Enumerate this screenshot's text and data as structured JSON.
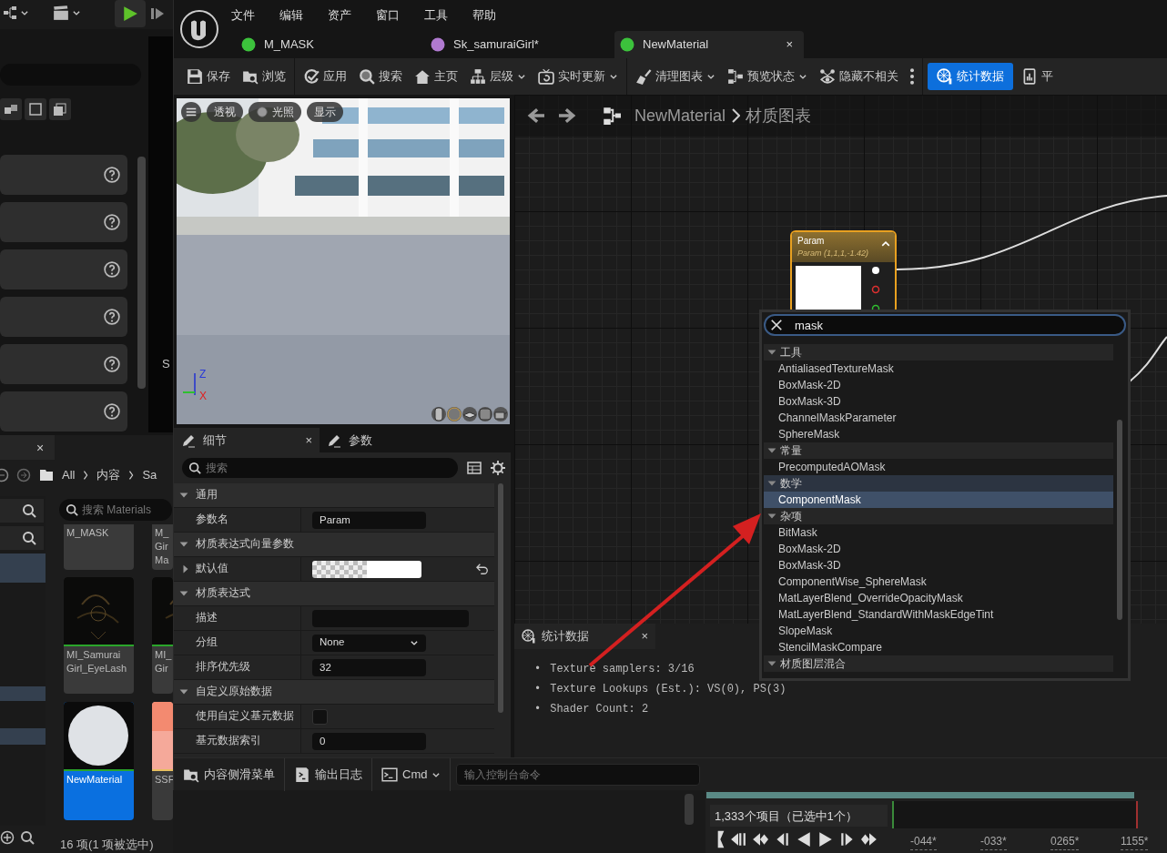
{
  "background_editor": {
    "side_label": "S",
    "content_browser": {
      "close": "×",
      "breadcrumbs": [
        "All",
        "内容",
        "Sa"
      ],
      "search_placeholder": "搜索 Materials",
      "assets": [
        {
          "label": "M_MASK",
          "kind": "none",
          "selected": false
        },
        {
          "label": "M_ Gir Ma",
          "kind": "none",
          "selected": false
        },
        {
          "label": "MI_Samurai Girl_EyeLash",
          "kind": "texture",
          "selected": false
        },
        {
          "label": "MI_ Gir",
          "kind": "texture",
          "selected": false
        },
        {
          "label": "NewMaterial",
          "kind": "sphere",
          "selected": true
        },
        {
          "label": "SSF",
          "kind": "salmon",
          "selected": false
        }
      ],
      "status": "16 项(1 项被选中)"
    },
    "outliner": {
      "status": "1,333个项目（已选中1个）"
    },
    "timeline": {
      "ticks": [
        "-044*",
        "-033*",
        "0265*",
        "1155*"
      ]
    }
  },
  "editor": {
    "menu": [
      "文件",
      "编辑",
      "资产",
      "窗口",
      "工具",
      "帮助"
    ],
    "tabs": [
      {
        "label": "M_MASK",
        "color": "#3cc23c",
        "selected": false
      },
      {
        "label": "Sk_samuraiGirl*",
        "color": "#b07ad0",
        "selected": false
      },
      {
        "label": "NewMaterial",
        "color": "#3cc23c",
        "selected": true,
        "close": "×"
      }
    ],
    "toolbar": [
      {
        "kind": "save",
        "label": "保存",
        "dropdown": false,
        "active": false
      },
      {
        "kind": "browse",
        "label": "浏览",
        "dropdown": false,
        "active": false
      },
      {
        "kind": "apply",
        "label": "应用",
        "dropdown": false,
        "active": false
      },
      {
        "kind": "search",
        "label": "搜索",
        "dropdown": false,
        "active": false
      },
      {
        "kind": "home",
        "label": "主页",
        "dropdown": false,
        "active": false
      },
      {
        "kind": "hierarchy",
        "label": "层级",
        "dropdown": true,
        "active": false
      },
      {
        "kind": "live",
        "label": "实时更新",
        "dropdown": true,
        "active": false
      },
      {
        "kind": "clean",
        "label": "清理图表",
        "dropdown": true,
        "active": false
      },
      {
        "kind": "preview",
        "label": "预览状态",
        "dropdown": true,
        "active": false
      },
      {
        "kind": "hide",
        "label": "隐藏不相关",
        "dropdown": false,
        "active": false
      },
      {
        "kind": "more",
        "dropdown": false,
        "active": false
      },
      {
        "kind": "stats",
        "label": "统计数据",
        "dropdown": false,
        "active": true
      },
      {
        "kind": "platform",
        "label": "平",
        "dropdown": false,
        "active": false
      }
    ],
    "viewport": {
      "buttons": [
        "透视",
        "光照",
        "显示"
      ],
      "axes": [
        "Z",
        "X"
      ]
    },
    "details": {
      "tabs": [
        {
          "label": "细节",
          "selected": true,
          "close": "×"
        },
        {
          "label": "参数",
          "selected": false
        }
      ],
      "search_placeholder": "搜索",
      "properties": [
        {
          "kind": "section",
          "label": "通用",
          "expanded": true
        },
        {
          "kind": "text",
          "label": "参数名",
          "value": "Param"
        },
        {
          "kind": "section",
          "label": "材质表达式向量参数",
          "expanded": true
        },
        {
          "kind": "color",
          "label": "默认值",
          "color": "#ffffff",
          "expanded": false
        },
        {
          "kind": "section",
          "label": "材质表达式",
          "expanded": true
        },
        {
          "kind": "text",
          "label": "描述"
        },
        {
          "kind": "dropdown",
          "label": "分组",
          "value": "None"
        },
        {
          "kind": "text",
          "label": "排序优先级",
          "value": "32"
        },
        {
          "kind": "section",
          "label": "自定义原始数据",
          "expanded": true
        },
        {
          "kind": "checkbox",
          "label": "使用自定义基元数据",
          "checked": false
        },
        {
          "kind": "text",
          "label": "基元数据索引",
          "value": "0"
        }
      ]
    },
    "graph": {
      "breadcrumb": [
        "NewMaterial",
        "材质图表"
      ],
      "node": {
        "title": "Param",
        "subtitle": "Param (1,1,1,-1.42)"
      }
    },
    "stats": {
      "tab": "统计数据",
      "close": "×",
      "bullet": "•",
      "lines": [
        "Texture samplers: 3/16",
        "Texture Lookups (Est.): VS(0), PS(3)",
        "Shader Count: 2"
      ]
    },
    "search_popup": {
      "value": "mask",
      "items": [
        {
          "kind": "category",
          "label": "工具",
          "active": false
        },
        {
          "kind": "item",
          "label": "AntialiasedTextureMask",
          "selected": false
        },
        {
          "kind": "item",
          "label": "BoxMask-2D",
          "selected": false
        },
        {
          "kind": "item",
          "label": "BoxMask-3D",
          "selected": false
        },
        {
          "kind": "item",
          "label": "ChannelMaskParameter",
          "selected": false
        },
        {
          "kind": "item",
          "label": "SphereMask",
          "selected": false
        },
        {
          "kind": "category",
          "label": "常量",
          "active": false
        },
        {
          "kind": "item",
          "label": "PrecomputedAOMask",
          "selected": false
        },
        {
          "kind": "category",
          "label": "数学",
          "active": true
        },
        {
          "kind": "item",
          "label": "ComponentMask",
          "selected": true
        },
        {
          "kind": "category",
          "label": "杂项",
          "active": false
        },
        {
          "kind": "item",
          "label": "BitMask",
          "selected": false
        },
        {
          "kind": "item",
          "label": "BoxMask-2D",
          "selected": false
        },
        {
          "kind": "item",
          "label": "BoxMask-3D",
          "selected": false
        },
        {
          "kind": "item",
          "label": "ComponentWise_SphereMask",
          "selected": false
        },
        {
          "kind": "item",
          "label": "MatLayerBlend_OverrideOpacityMask",
          "selected": false
        },
        {
          "kind": "item",
          "label": "MatLayerBlend_StandardWithMaskEdgeTint",
          "selected": false
        },
        {
          "kind": "item",
          "label": "SlopeMask",
          "selected": false
        },
        {
          "kind": "item",
          "label": "StencilMaskCompare",
          "selected": false
        },
        {
          "kind": "category",
          "label": "材质图层混合",
          "active": false
        }
      ]
    },
    "bottom_bar": {
      "buttons": [
        {
          "kind": "drawer",
          "label": "内容侧滑菜单",
          "dropdown": false
        },
        {
          "kind": "log",
          "label": "输出日志",
          "dropdown": false
        },
        {
          "kind": "cmd",
          "label": "Cmd",
          "dropdown": true
        }
      ],
      "console_placeholder": "输入控制台命令"
    }
  }
}
